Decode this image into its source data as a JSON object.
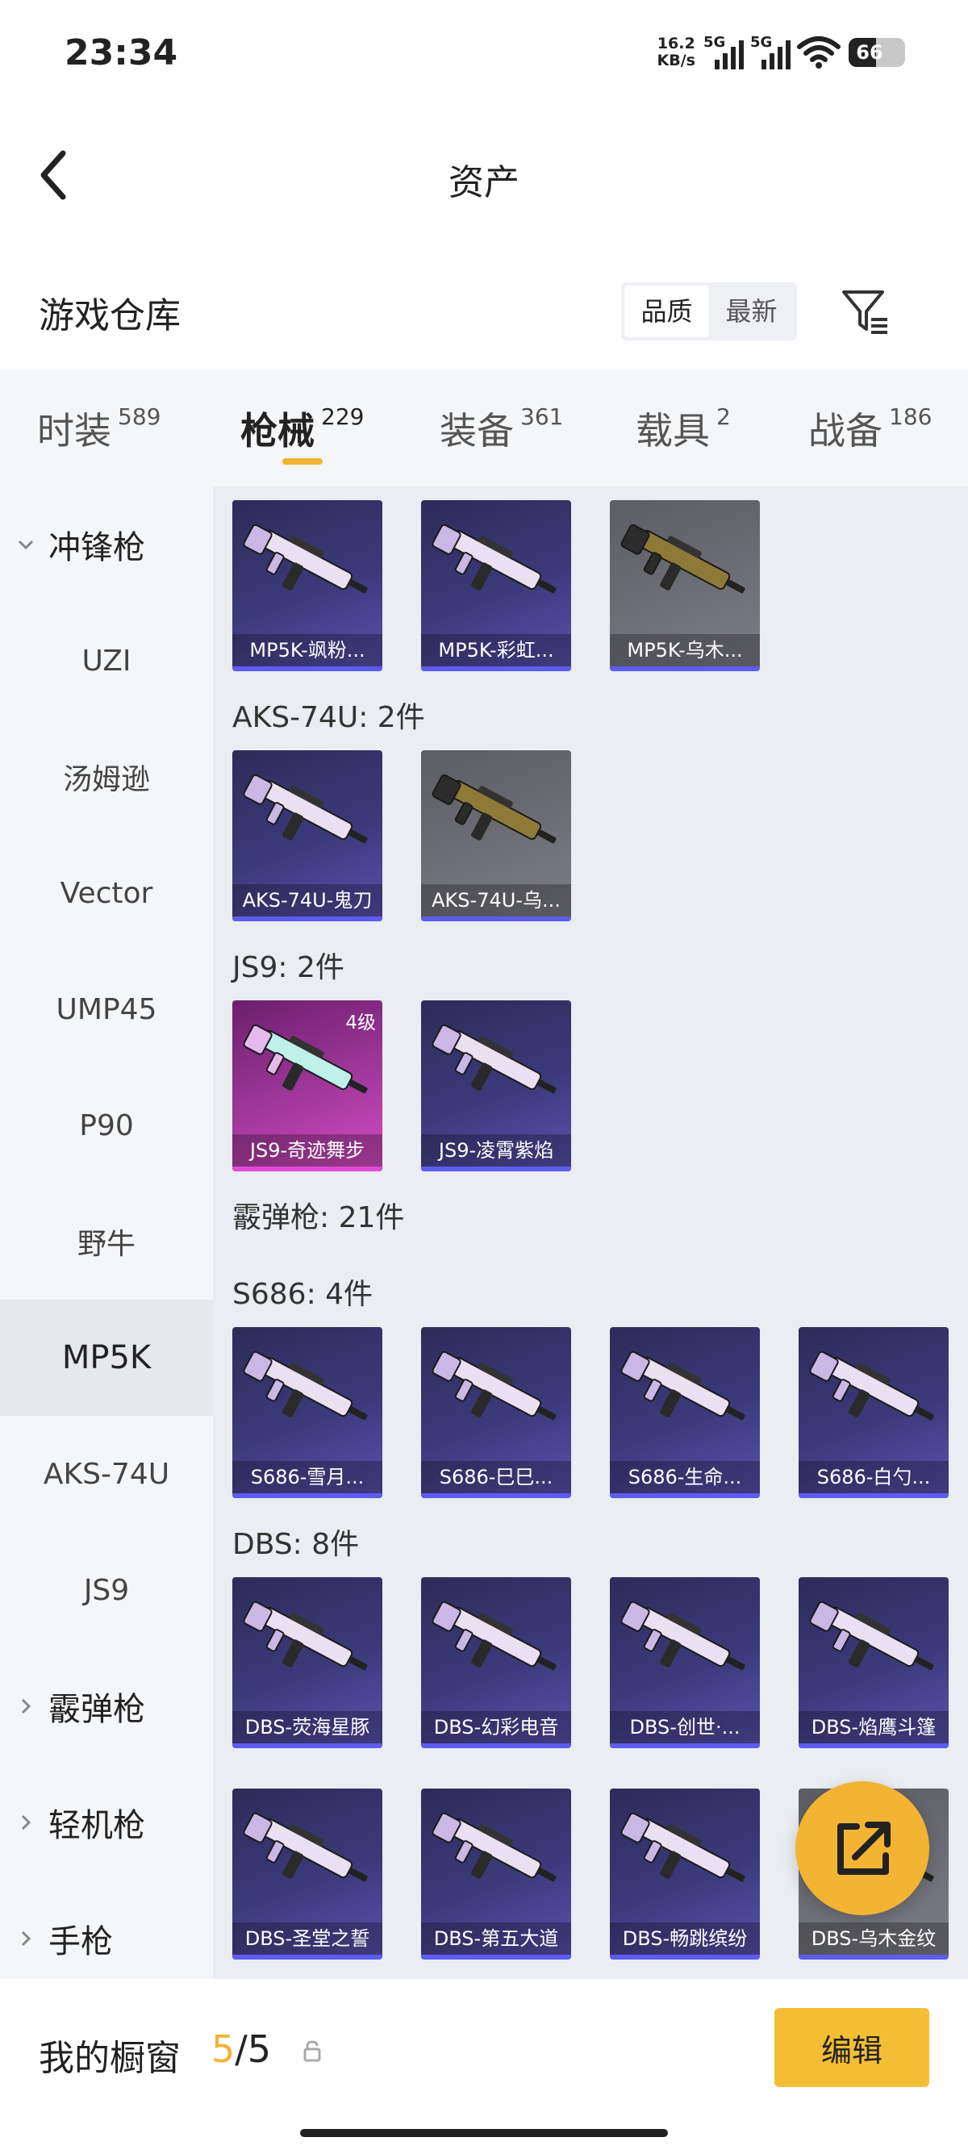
{
  "status_bar": {
    "time": "23:34",
    "net_speed_value": "16.2",
    "net_speed_unit": "KB/s",
    "sim1": "5G",
    "sim2": "5G",
    "battery": "66",
    "icons": [
      "signal-icon",
      "wifi-icon",
      "battery-icon"
    ]
  },
  "header": {
    "title": "资产",
    "back_icon": "chevron-left-icon"
  },
  "warehouse": {
    "title": "游戏仓库",
    "sort_options": [
      "品质",
      "最新"
    ],
    "sort_selected": "品质",
    "filter_icon": "filter-icon"
  },
  "tabs": [
    {
      "label": "时装",
      "count": "589"
    },
    {
      "label": "枪械",
      "count": "229"
    },
    {
      "label": "装备",
      "count": "361"
    },
    {
      "label": "载具",
      "count": "2"
    },
    {
      "label": "战备",
      "count": "186"
    }
  ],
  "active_tab": "枪械",
  "sidebar": {
    "items": [
      {
        "label": "冲锋枪",
        "type": "group",
        "expanded": true
      },
      {
        "label": "UZI",
        "type": "sub"
      },
      {
        "label": "汤姆逊",
        "type": "sub"
      },
      {
        "label": "Vector",
        "type": "sub"
      },
      {
        "label": "UMP45",
        "type": "sub"
      },
      {
        "label": "P90",
        "type": "sub"
      },
      {
        "label": "野牛",
        "type": "sub"
      },
      {
        "label": "MP5K",
        "type": "sub",
        "selected": true
      },
      {
        "label": "AKS-74U",
        "type": "sub"
      },
      {
        "label": "JS9",
        "type": "sub"
      },
      {
        "label": "霰弹枪",
        "type": "group",
        "expanded": false
      },
      {
        "label": "轻机枪",
        "type": "group",
        "expanded": false
      },
      {
        "label": "手枪",
        "type": "group",
        "expanded": false
      }
    ]
  },
  "sections": [
    {
      "label": "",
      "items": [
        {
          "name": "MP5K-飒粉...",
          "rarity": "purple"
        },
        {
          "name": "MP5K-彩虹...",
          "rarity": "purple"
        },
        {
          "name": "MP5K-乌木...",
          "rarity": "gray"
        }
      ]
    },
    {
      "label": "AKS-74U: 2件",
      "items": [
        {
          "name": "AKS-74U-鬼刀",
          "rarity": "purple"
        },
        {
          "name": "AKS-74U-乌...",
          "rarity": "gray"
        }
      ]
    },
    {
      "label": "JS9: 2件",
      "items": [
        {
          "name": "JS9-奇迹舞步",
          "rarity": "pink",
          "level": "4级"
        },
        {
          "name": "JS9-凌霄紫焰",
          "rarity": "purple"
        }
      ]
    },
    {
      "label": "霰弹枪: 21件",
      "items": []
    },
    {
      "label": "S686: 4件",
      "items": [
        {
          "name": "S686-雪月...",
          "rarity": "purple"
        },
        {
          "name": "S686-巳巳...",
          "rarity": "purple"
        },
        {
          "name": "S686-生命...",
          "rarity": "purple"
        },
        {
          "name": "S686-白勺...",
          "rarity": "purple"
        }
      ]
    },
    {
      "label": "DBS: 8件",
      "items": [
        {
          "name": "DBS-荧海星豚",
          "rarity": "purple"
        },
        {
          "name": "DBS-幻彩电音",
          "rarity": "purple"
        },
        {
          "name": "DBS-创世·...",
          "rarity": "purple"
        },
        {
          "name": "DBS-焰鹰斗篷",
          "rarity": "purple"
        },
        {
          "name": "DBS-圣堂之誓",
          "rarity": "purple"
        },
        {
          "name": "DBS-第五大道",
          "rarity": "purple"
        },
        {
          "name": "DBS-畅跳缤纷",
          "rarity": "purple"
        },
        {
          "name": "DBS-乌木金纹",
          "rarity": "gray"
        }
      ]
    }
  ],
  "fab": {
    "icon": "share-external-icon"
  },
  "showcase": {
    "title": "我的橱窗",
    "current": "5",
    "separator": "/",
    "total": "5",
    "lock_icon": "lock-icon",
    "edit_label": "编辑"
  },
  "colors": {
    "accent": "#f3b433",
    "rarity_purple": "#3d3a7c",
    "rarity_gray": "#6e6f76",
    "rarity_pink": "#a2389d",
    "content_bg": "#eaedf1",
    "sidebar_bg": "#f5f6f8"
  }
}
